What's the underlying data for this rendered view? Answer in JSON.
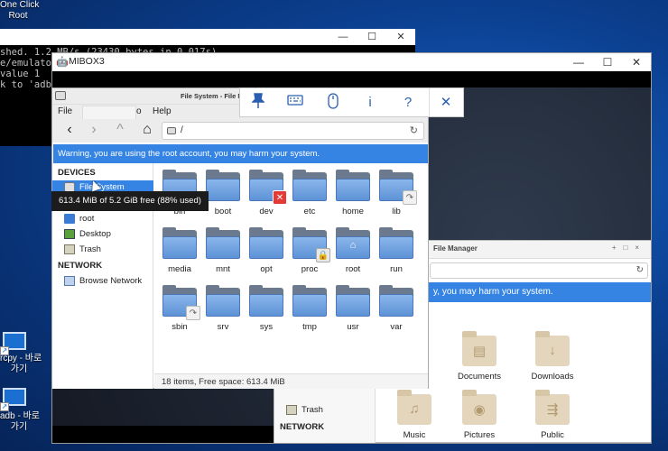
{
  "desktop": {
    "icons": [
      {
        "label": "One Click\nRoot"
      },
      {
        "label": "rcpy - 바로\n가기"
      },
      {
        "label": "adb - 바로\n가기"
      }
    ]
  },
  "cmd_window": {
    "lines": [
      "shed. 1.2 MB/s (23430 bytes in 0.017s)",
      "e/emulator",
      "value 1",
      "k to 'adb f"
    ]
  },
  "mibox": {
    "title": "MIBOX3",
    "controls": {
      "minimize": "—",
      "maximize": "☐",
      "close": "✕"
    }
  },
  "file_manager": {
    "title": "File System - File Manager",
    "menu": {
      "file": "File",
      "go": "o",
      "help": "Help"
    },
    "path": "/",
    "warning": "Warning, you are using the root account, you may harm your system.",
    "sidebar": {
      "devices_heading": "DEVICES",
      "items": [
        {
          "label": "File System",
          "icon": "drive-icon"
        },
        {
          "label": "root",
          "icon": "home-icon"
        },
        {
          "label": "Desktop",
          "icon": "desktop-icon"
        },
        {
          "label": "Trash",
          "icon": "trash-icon"
        }
      ],
      "network_heading": "NETWORK",
      "network_items": [
        {
          "label": "Browse Network",
          "icon": "network-icon"
        }
      ]
    },
    "folders": [
      {
        "name": "bin",
        "emblem": ""
      },
      {
        "name": "boot",
        "emblem": ""
      },
      {
        "name": "dev",
        "emblem": "x"
      },
      {
        "name": "etc",
        "emblem": ""
      },
      {
        "name": "home",
        "emblem": ""
      },
      {
        "name": "lib",
        "emblem": "link"
      },
      {
        "name": "media",
        "emblem": ""
      },
      {
        "name": "mnt",
        "emblem": ""
      },
      {
        "name": "opt",
        "emblem": ""
      },
      {
        "name": "proc",
        "emblem": "lock"
      },
      {
        "name": "root",
        "emblem": "home"
      },
      {
        "name": "run",
        "emblem": ""
      },
      {
        "name": "sbin",
        "emblem": "link"
      },
      {
        "name": "srv",
        "emblem": ""
      },
      {
        "name": "sys",
        "emblem": ""
      },
      {
        "name": "tmp",
        "emblem": ""
      },
      {
        "name": "usr",
        "emblem": ""
      },
      {
        "name": "var",
        "emblem": ""
      }
    ],
    "status": "18 items, Free space: 613.4 MiB"
  },
  "tooltip": "613.4 MiB of 5.2 GiB free (88% used)",
  "floating_toolbar": {
    "buttons": [
      {
        "icon": "pin-icon",
        "glyph": "📌"
      },
      {
        "icon": "keyboard-icon",
        "glyph": "⌨"
      },
      {
        "icon": "mouse-icon",
        "glyph": "🖱"
      },
      {
        "icon": "info-icon",
        "glyph": "i"
      },
      {
        "icon": "help-icon",
        "glyph": "?"
      },
      {
        "icon": "close-icon",
        "glyph": "✕"
      }
    ]
  },
  "file_manager_2": {
    "title": "File Manager",
    "warning": "y, you may harm your system.",
    "sidebar": {
      "trash": "Trash",
      "network_heading": "NETWORK"
    },
    "folders": [
      "Documents",
      "Downloads",
      "Music",
      "Pictures",
      "Public"
    ]
  }
}
